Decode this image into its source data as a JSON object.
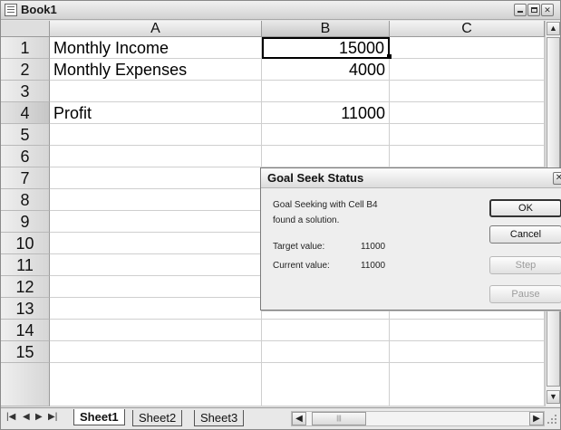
{
  "window": {
    "title": "Book1"
  },
  "columns": [
    "A",
    "B",
    "C"
  ],
  "rows": [
    {
      "num": "1",
      "a": "Monthly Income",
      "b": "15000"
    },
    {
      "num": "2",
      "a": "Monthly Expenses",
      "b": "4000"
    },
    {
      "num": "3",
      "a": "",
      "b": ""
    },
    {
      "num": "4",
      "a": "Profit",
      "b": "11000"
    },
    {
      "num": "5",
      "a": "",
      "b": ""
    },
    {
      "num": "6",
      "a": "",
      "b": ""
    },
    {
      "num": "7",
      "a": "",
      "b": ""
    },
    {
      "num": "8",
      "a": "",
      "b": ""
    },
    {
      "num": "9",
      "a": "",
      "b": ""
    },
    {
      "num": "10",
      "a": "",
      "b": ""
    },
    {
      "num": "11",
      "a": "",
      "b": ""
    },
    {
      "num": "12",
      "a": "",
      "b": ""
    },
    {
      "num": "13",
      "a": "",
      "b": ""
    },
    {
      "num": "14",
      "a": "",
      "b": ""
    },
    {
      "num": "15",
      "a": "",
      "b": ""
    }
  ],
  "sheets": [
    "Sheet1",
    "Sheet2",
    "Sheet3"
  ],
  "dialog": {
    "title": "Goal Seek Status",
    "message_line1": "Goal Seeking with Cell B4",
    "message_line2": "found a solution.",
    "target_label": "Target value:",
    "target_value": "11000",
    "current_label": "Current value:",
    "current_value": "11000",
    "ok_label": "OK",
    "cancel_label": "Cancel",
    "step_label": "Step",
    "pause_label": "Pause"
  }
}
